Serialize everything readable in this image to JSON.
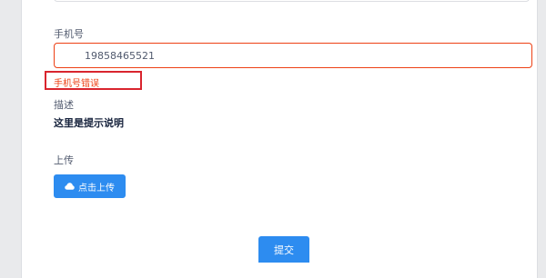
{
  "form": {
    "phone": {
      "label": "手机号",
      "value": "19858465521",
      "error": "手机号错误"
    },
    "description": {
      "label": "描述",
      "text": "这里是提示说明"
    },
    "upload": {
      "label": "上传",
      "button_label": "点击上传",
      "icon": "cloud-upload-icon"
    },
    "submit_label": "提交"
  },
  "colors": {
    "primary": "#2d8cf0",
    "error": "#ed4014",
    "highlight": "#d9252e",
    "border": "#dcdee2"
  }
}
